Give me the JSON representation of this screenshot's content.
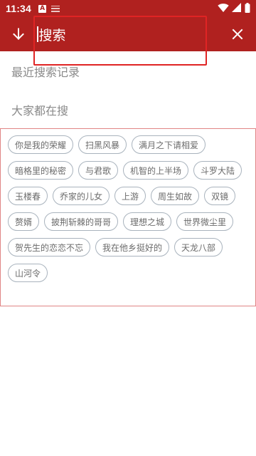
{
  "status_bar": {
    "time": "11:34",
    "notification_letter": "A"
  },
  "toolbar": {
    "search_placeholder": "搜索",
    "back_icon": "arrow-down-icon",
    "close_icon": "close-icon"
  },
  "sections": {
    "recent_title": "最近搜索记录",
    "hot_title": "大家都在搜"
  },
  "hot_tags": [
    "你是我的荣耀",
    "扫黑风暴",
    "满月之下请相爱",
    "暗格里的秘密",
    "与君歌",
    "机智的上半场",
    "斗罗大陆",
    "玉楼春",
    "乔家的儿女",
    "上游",
    "周生如故",
    "双镜",
    "赘婿",
    "披荆斩棘的哥哥",
    "理想之城",
    "世界微尘里",
    "贺先生的恋恋不忘",
    "我在他乡挺好的",
    "天龙八部",
    "山河令"
  ],
  "colors": {
    "brand_red": "#b0211f",
    "highlight_red": "#e02424",
    "tag_border": "#a9b3bd",
    "box_border": "#e08585"
  }
}
